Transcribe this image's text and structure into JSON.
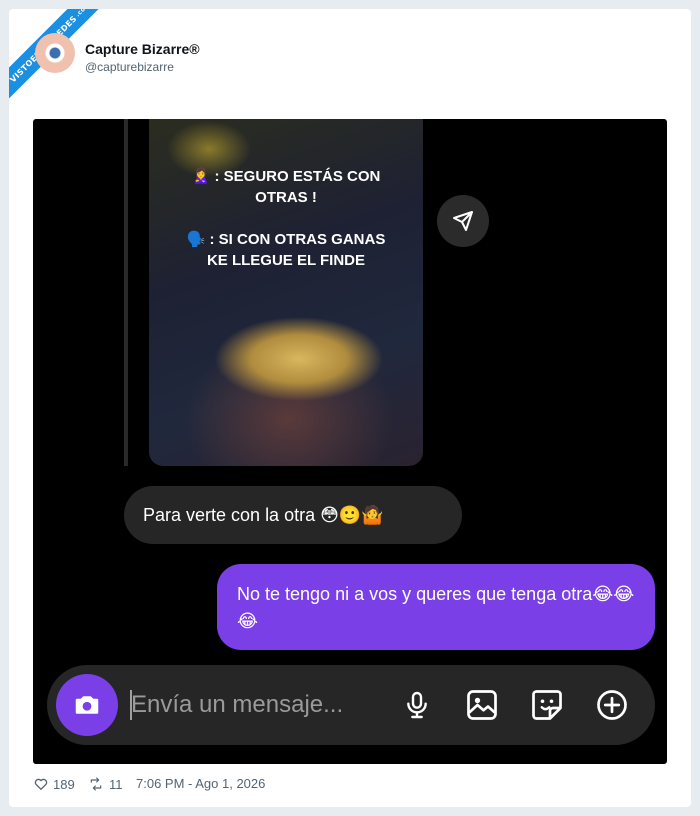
{
  "watermark": {
    "text": "VISTOENLASREDES",
    "sub": ".com"
  },
  "author": {
    "name": "Capture Bizarre®",
    "handle": "@capturebizarre"
  },
  "story": {
    "line1": "🙎‍♀️ : SEGURO ESTÁS CON",
    "line2": "OTRAS !",
    "line3": "🗣️ : SI CON OTRAS GANAS",
    "line4": "KE LLEGUE EL FINDE"
  },
  "reaction": {
    "emoji": "😂"
  },
  "messages": {
    "incoming": "Para verte con la otra 😳🙂🤷",
    "outgoing": "No te tengo ni a vos y queres que tenga otra😂😂😂"
  },
  "composer": {
    "placeholder": "Envía un mensaje..."
  },
  "tweet_meta": {
    "likes": "189",
    "retweets": "11",
    "timestamp": "7:06 PM - Ago 1, 2026"
  },
  "colors": {
    "accent": "#7b3fe8",
    "bubble_dark": "#262626",
    "ribbon": "#1b8fe0"
  }
}
